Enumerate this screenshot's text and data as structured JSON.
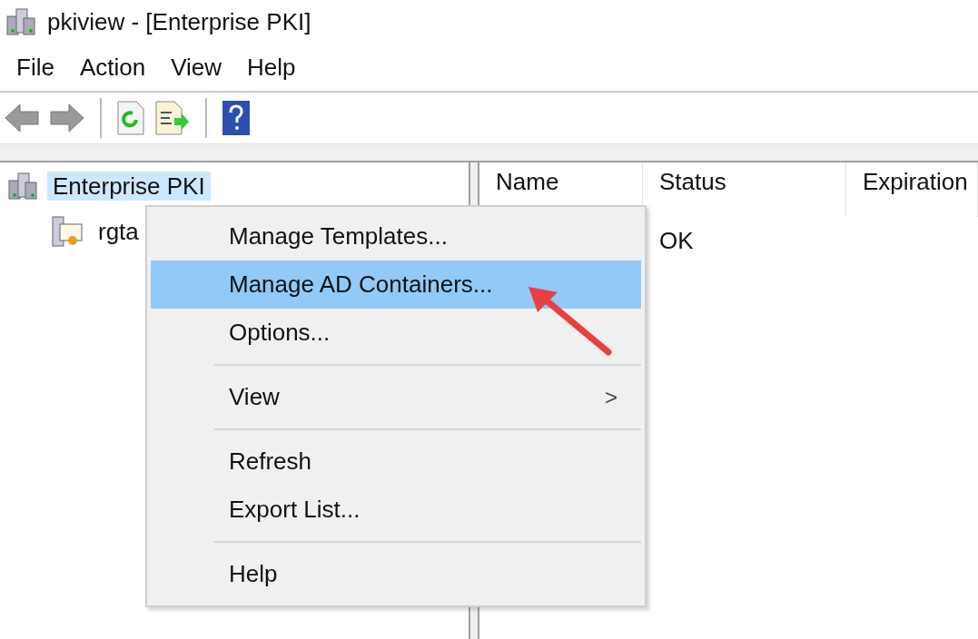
{
  "window": {
    "title": "pkiview - [Enterprise PKI]"
  },
  "menu_bar": [
    "File",
    "Action",
    "View",
    "Help"
  ],
  "tree": [
    {
      "label": "Enterprise PKI",
      "selected": true,
      "children": [
        {
          "label": "rgta",
          "selected": false
        }
      ]
    }
  ],
  "list": {
    "columns": [
      "Name",
      "Status",
      "Expiration"
    ],
    "rows": [
      {
        "status": "OK"
      }
    ]
  },
  "context_menu": [
    {
      "kind": "item",
      "label": "Manage Templates...",
      "selected": false
    },
    {
      "kind": "item",
      "label": "Manage AD Containers...",
      "selected": true
    },
    {
      "kind": "item",
      "label": "Options...",
      "selected": false
    },
    {
      "kind": "separator"
    },
    {
      "kind": "submenu",
      "label": "View",
      "selected": false,
      "arrow": ">"
    },
    {
      "kind": "separator"
    },
    {
      "kind": "item",
      "label": "Refresh",
      "selected": false
    },
    {
      "kind": "item",
      "label": "Export List...",
      "selected": false
    },
    {
      "kind": "separator"
    },
    {
      "kind": "item",
      "label": "Help",
      "selected": false
    }
  ]
}
